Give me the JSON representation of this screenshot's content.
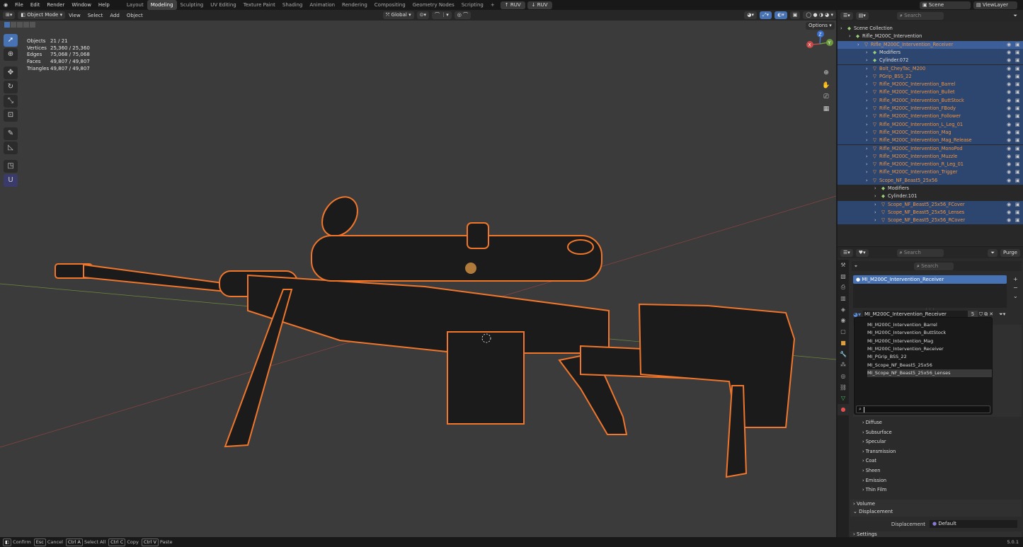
{
  "menubar": {
    "items": [
      "File",
      "Edit",
      "Render",
      "Window",
      "Help"
    ]
  },
  "workspaces": {
    "items": [
      "Layout",
      "Modeling",
      "Sculpting",
      "UV Editing",
      "Texture Paint",
      "Shading",
      "Animation",
      "Rendering",
      "Compositing",
      "Geometry Nodes",
      "Scripting"
    ],
    "active": "Modeling",
    "plus": "+",
    "ruv1": "RUV",
    "ruv2": "RUV"
  },
  "scene": {
    "label": "Scene",
    "viewlayer": "ViewLayer"
  },
  "viewport_header": {
    "mode": "Object Mode",
    "menus": [
      "View",
      "Select",
      "Add",
      "Object"
    ],
    "orientation": "Global",
    "options": "Options"
  },
  "stats": {
    "rows": [
      {
        "k": "Objects",
        "v": "21 / 21"
      },
      {
        "k": "Vertices",
        "v": "25,360 / 25,360"
      },
      {
        "k": "Edges",
        "v": "75,068 / 75,068"
      },
      {
        "k": "Faces",
        "v": "49,807 / 49,807"
      },
      {
        "k": "Triangles",
        "v": "49,807 / 49,807"
      }
    ]
  },
  "gizmo": {
    "x": "X",
    "y": "Y",
    "z": "Z"
  },
  "outliner": {
    "search_placeholder": "Search",
    "rows": [
      {
        "label": "Scene Collection",
        "state": "",
        "color": "wh",
        "indent": 0
      },
      {
        "label": "Rifle_M200C_Intervention",
        "state": "",
        "color": "wh",
        "indent": 1
      },
      {
        "label": "Rifle_M200C_Intervention_Receiver",
        "state": "hl",
        "color": "or",
        "indent": 2
      },
      {
        "label": "Modifiers",
        "state": "sel",
        "color": "wh",
        "indent": 3
      },
      {
        "label": "Cylinder.072",
        "state": "sel",
        "color": "wh",
        "indent": 3
      },
      {
        "label": "Bolt_CheyTac_M200",
        "state": "sel",
        "color": "or",
        "indent": 3
      },
      {
        "label": "PGrip_BSS_22",
        "state": "sel",
        "color": "or",
        "indent": 3
      },
      {
        "label": "Rifle_M200C_Intervention_Barrel",
        "state": "sel",
        "color": "or",
        "indent": 3
      },
      {
        "label": "Rifle_M200C_Intervention_Bullet",
        "state": "sel",
        "color": "or",
        "indent": 3
      },
      {
        "label": "Rifle_M200C_Intervention_ButtStock",
        "state": "sel",
        "color": "or",
        "indent": 3
      },
      {
        "label": "Rifle_M200C_Intervention_FBody",
        "state": "sel",
        "color": "or",
        "indent": 3
      },
      {
        "label": "Rifle_M200C_Intervention_Follower",
        "state": "sel",
        "color": "or",
        "indent": 3
      },
      {
        "label": "Rifle_M200C_Intervention_L_Leg_01",
        "state": "sel",
        "color": "or",
        "indent": 3
      },
      {
        "label": "Rifle_M200C_Intervention_Mag",
        "state": "sel",
        "color": "or",
        "indent": 3
      },
      {
        "label": "Rifle_M200C_Intervention_Mag_Release",
        "state": "sel",
        "color": "or",
        "indent": 3
      },
      {
        "label": "Rifle_M200C_Intervention_MonoPod",
        "state": "sel",
        "color": "or",
        "indent": 3
      },
      {
        "label": "Rifle_M200C_Intervention_Muzzle",
        "state": "sel",
        "color": "or",
        "indent": 3
      },
      {
        "label": "Rifle_M200C_Intervention_R_Leg_01",
        "state": "sel",
        "color": "or",
        "indent": 3
      },
      {
        "label": "Rifle_M200C_Intervention_Trigger",
        "state": "sel",
        "color": "or",
        "indent": 3
      },
      {
        "label": "Scope_NF_Beast5_25x56",
        "state": "sel",
        "color": "or",
        "indent": 3
      },
      {
        "label": "Modifiers",
        "state": "",
        "color": "wh",
        "indent": 4
      },
      {
        "label": "Cylinder.101",
        "state": "",
        "color": "wh",
        "indent": 4
      },
      {
        "label": "Scope_NF_Beast5_25x56_FCover",
        "state": "sel",
        "color": "or",
        "indent": 4
      },
      {
        "label": "Scope_NF_Beast5_25x56_Lenses",
        "state": "sel",
        "color": "or",
        "indent": 4
      },
      {
        "label": "Scope_NF_Beast5_25x56_RCover",
        "state": "sel",
        "color": "or",
        "indent": 4
      }
    ]
  },
  "properties": {
    "search_placeholder": "Search",
    "purge": "Purge",
    "slot": "MI_M200C_Intervention_Receiver",
    "material_name": "MI_M200C_Intervention_Receiver",
    "users": "5",
    "popup_items": [
      "MI_M200C_Intervention_Barrel",
      "MI_M200C_Intervention_ButtStock",
      "MI_M200C_Intervention_Mag",
      "MI_M200C_Intervention_Receiver",
      "MI_PGrip_BSS_22",
      "MI_Scope_NF_Beast5_25x56",
      "MI_Scope_NF_Beast5_25x56_Lenses"
    ],
    "sections": [
      "Diffuse",
      "Subsurface",
      "Specular",
      "Transmission",
      "Coat",
      "Sheen",
      "Emission",
      "Thin Film"
    ],
    "volume": "Volume",
    "displacement_panel": "Displacement",
    "displacement_label": "Displacement",
    "displacement_value": "Default",
    "settings": "Settings"
  },
  "statusbar": {
    "items": [
      {
        "key": "",
        "label": "Confirm"
      },
      {
        "key": "Esc",
        "label": "Cancel"
      },
      {
        "key": "Ctrl A",
        "label": "Select All"
      },
      {
        "key": "Ctrl C",
        "label": "Copy"
      },
      {
        "key": "Ctrl V",
        "label": "Paste"
      }
    ],
    "version": "5.0.1"
  },
  "colors": {
    "accent": "#4772b3",
    "outline": "#f0762c",
    "selected_row": "#2d4670"
  }
}
